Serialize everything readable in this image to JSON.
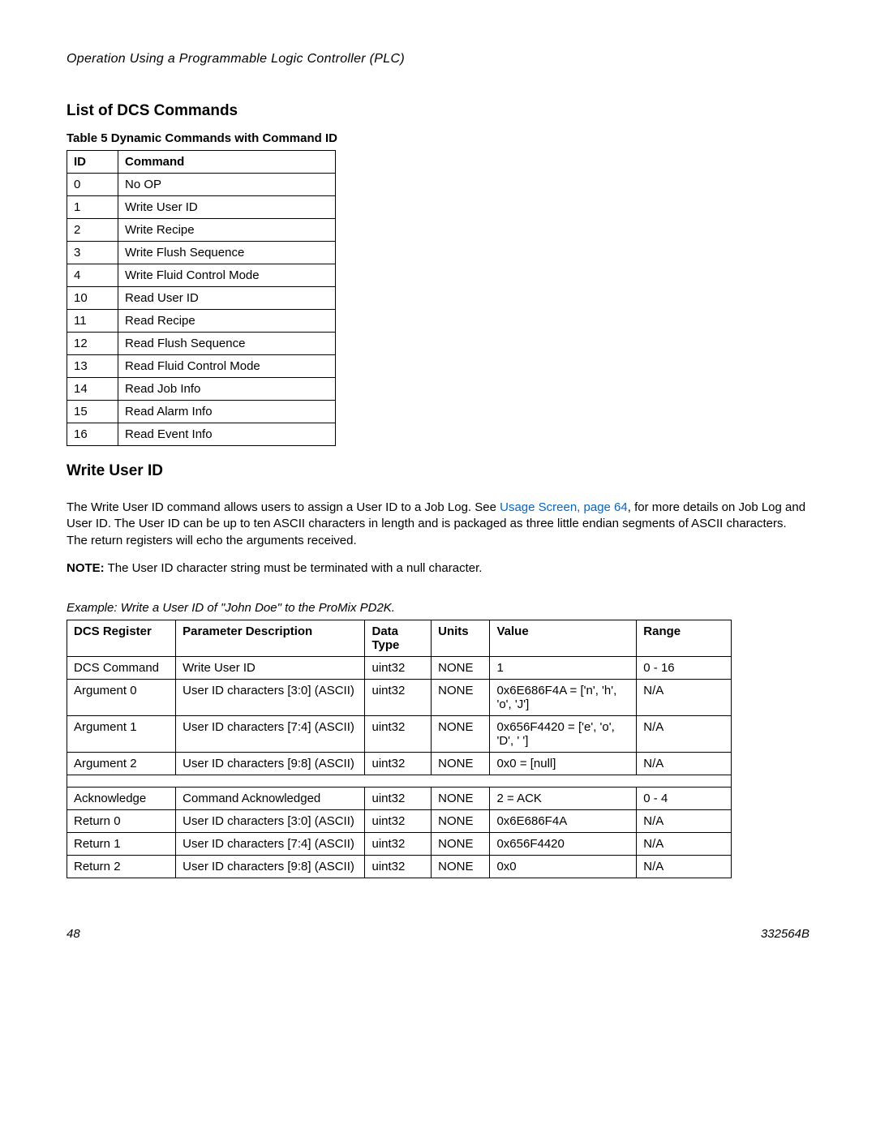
{
  "header": {
    "section": "Operation Using a Programmable Logic Controller (PLC)"
  },
  "heading1": "List of DCS Commands",
  "table1_caption": "Table 5 Dynamic Commands with Command ID",
  "table1": {
    "headers": {
      "id": "ID",
      "command": "Command"
    },
    "rows": [
      {
        "id": "0",
        "command": "No OP"
      },
      {
        "id": "1",
        "command": "Write User ID"
      },
      {
        "id": "2",
        "command": "Write Recipe"
      },
      {
        "id": "3",
        "command": "Write Flush Sequence"
      },
      {
        "id": "4",
        "command": "Write Fluid Control Mode"
      },
      {
        "id": "10",
        "command": "Read User ID"
      },
      {
        "id": "11",
        "command": "Read Recipe"
      },
      {
        "id": "12",
        "command": "Read Flush Sequence"
      },
      {
        "id": "13",
        "command": "Read Fluid Control Mode"
      },
      {
        "id": "14",
        "command": "Read Job Info"
      },
      {
        "id": "15",
        "command": "Read Alarm Info"
      },
      {
        "id": "16",
        "command": "Read Event Info"
      }
    ]
  },
  "heading2": "Write User ID",
  "para1_a": "The Write User ID command allows users to assign a User ID to a Job Log. See ",
  "para1_link": "Usage Screen, page 64",
  "para1_b": ", for more details on Job Log and User ID. The User ID can be up to ten ASCII characters in length and is packaged as three little endian segments of ASCII characters. The return registers will echo the arguments received.",
  "note_label": "NOTE:",
  "note_text": " The User ID character string must be terminated with a null character.",
  "example_text": "Example: Write a User ID of \"John Doe\" to the ProMix PD2K.",
  "table2": {
    "headers": {
      "reg": "DCS Register",
      "desc": "Parameter Description",
      "type": "Data Type",
      "units": "Units",
      "value": "Value",
      "range": "Range"
    },
    "rows_top": [
      {
        "reg": "DCS Command",
        "desc": "Write User ID",
        "type": "uint32",
        "units": "NONE",
        "value": "1",
        "range": "0 - 16"
      },
      {
        "reg": "Argument 0",
        "desc": "User ID characters [3:0] (ASCII)",
        "type": "uint32",
        "units": "NONE",
        "value": "0x6E686F4A = ['n', 'h', 'o', 'J']",
        "range": "N/A"
      },
      {
        "reg": "Argument 1",
        "desc": "User ID characters [7:4] (ASCII)",
        "type": "uint32",
        "units": "NONE",
        "value": "0x656F4420 = ['e', 'o', 'D', ' ']",
        "range": "N/A"
      },
      {
        "reg": "Argument 2",
        "desc": "User ID characters [9:8] (ASCII)",
        "type": "uint32",
        "units": "NONE",
        "value": "0x0 = [null]",
        "range": "N/A"
      }
    ],
    "rows_bottom": [
      {
        "reg": "Acknowledge",
        "desc": "Command Acknowledged",
        "type": "uint32",
        "units": "NONE",
        "value": "2 = ACK",
        "range": "0 - 4"
      },
      {
        "reg": "Return 0",
        "desc": "User ID characters [3:0] (ASCII)",
        "type": "uint32",
        "units": "NONE",
        "value": "0x6E686F4A",
        "range": "N/A"
      },
      {
        "reg": "Return 1",
        "desc": "User ID characters [7:4] (ASCII)",
        "type": "uint32",
        "units": "NONE",
        "value": "0x656F4420",
        "range": "N/A"
      },
      {
        "reg": "Return 2",
        "desc": "User ID characters [9:8] (ASCII)",
        "type": "uint32",
        "units": "NONE",
        "value": "0x0",
        "range": "N/A"
      }
    ]
  },
  "footer": {
    "page": "48",
    "doc": "332564B"
  }
}
